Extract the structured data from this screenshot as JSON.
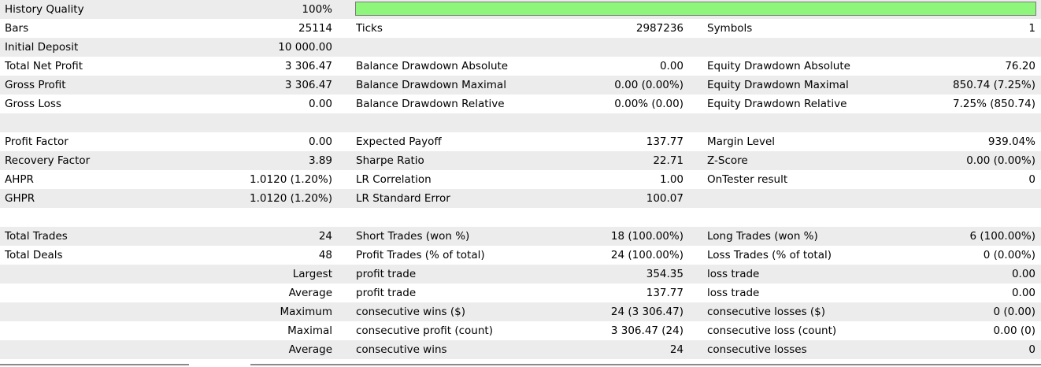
{
  "colors": {
    "row_shade": "#ececec",
    "row_plain": "#ffffff",
    "quality_fill": "#8ef67a",
    "quality_border": "#7a7a7a"
  },
  "history_quality": {
    "label": "History Quality",
    "value": "100%",
    "fill_percent": 100
  },
  "rows": [
    {
      "shade": true,
      "cells": [
        "",
        "",
        "",
        "",
        "",
        ""
      ]
    },
    {
      "shade": false,
      "cells": [
        "Bars",
        "25114",
        "Ticks",
        "2987236",
        "Symbols",
        "1"
      ]
    },
    {
      "shade": true,
      "cells": [
        "Initial Deposit",
        "10 000.00",
        "",
        "",
        "",
        ""
      ]
    },
    {
      "shade": false,
      "cells": [
        "Total Net Profit",
        "3 306.47",
        "Balance Drawdown Absolute",
        "0.00",
        "Equity Drawdown Absolute",
        "76.20"
      ]
    },
    {
      "shade": true,
      "cells": [
        "Gross Profit",
        "3 306.47",
        "Balance Drawdown Maximal",
        "0.00 (0.00%)",
        "Equity Drawdown Maximal",
        "850.74 (7.25%)"
      ]
    },
    {
      "shade": false,
      "cells": [
        "Gross Loss",
        "0.00",
        "Balance Drawdown Relative",
        "0.00% (0.00)",
        "Equity Drawdown Relative",
        "7.25% (850.74)"
      ]
    },
    {
      "shade": true,
      "cells": [
        "",
        "",
        "",
        "",
        "",
        ""
      ]
    },
    {
      "shade": false,
      "cells": [
        "Profit Factor",
        "0.00",
        "Expected Payoff",
        "137.77",
        "Margin Level",
        "939.04%"
      ]
    },
    {
      "shade": true,
      "cells": [
        "Recovery Factor",
        "3.89",
        "Sharpe Ratio",
        "22.71",
        "Z-Score",
        "0.00 (0.00%)"
      ]
    },
    {
      "shade": false,
      "cells": [
        "AHPR",
        "1.0120 (1.20%)",
        "LR Correlation",
        "1.00",
        "OnTester result",
        "0"
      ]
    },
    {
      "shade": true,
      "cells": [
        "GHPR",
        "1.0120 (1.20%)",
        "LR Standard Error",
        "100.07",
        "",
        ""
      ]
    },
    {
      "shade": false,
      "cells": [
        "",
        "",
        "",
        "",
        "",
        ""
      ]
    },
    {
      "shade": true,
      "cells": [
        "Total Trades",
        "24",
        "Short Trades (won %)",
        "18 (100.00%)",
        "Long Trades (won %)",
        "6 (100.00%)"
      ]
    },
    {
      "shade": false,
      "cells": [
        "Total Deals",
        "48",
        "Profit Trades (% of total)",
        "24 (100.00%)",
        "Loss Trades (% of total)",
        "0 (0.00%)"
      ]
    },
    {
      "shade": true,
      "cells": [
        "",
        "Largest",
        "profit trade",
        "354.35",
        "loss trade",
        "0.00"
      ]
    },
    {
      "shade": false,
      "cells": [
        "",
        "Average",
        "profit trade",
        "137.77",
        "loss trade",
        "0.00"
      ]
    },
    {
      "shade": true,
      "cells": [
        "",
        "Maximum",
        "consecutive wins ($)",
        "24 (3 306.47)",
        "consecutive losses ($)",
        "0 (0.00)"
      ]
    },
    {
      "shade": false,
      "cells": [
        "",
        "Maximal",
        "consecutive profit (count)",
        "3 306.47 (24)",
        "consecutive loss (count)",
        "0.00 (0)"
      ]
    },
    {
      "shade": true,
      "cells": [
        "",
        "Average",
        "consecutive wins",
        "24",
        "consecutive losses",
        "0"
      ]
    }
  ]
}
